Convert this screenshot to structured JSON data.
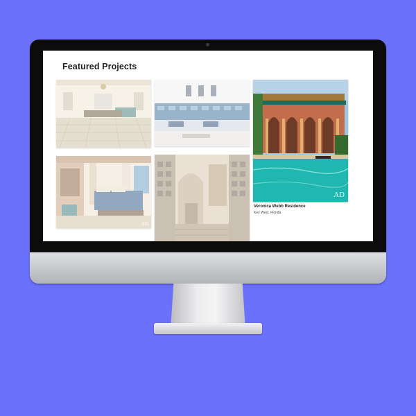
{
  "page": {
    "title": "Featured Projects"
  },
  "projects": [
    {
      "name": "interior-tiled-hall",
      "faded": true
    },
    {
      "name": "interior-lounge-seating",
      "faded": true
    },
    {
      "name": "veronica-webb-residence",
      "faded": false
    },
    {
      "name": "interior-bedroom",
      "faded": true
    },
    {
      "name": "interior-tiled-courtyard",
      "faded": true
    }
  ],
  "featured": {
    "title": "Veronica Webb Residence",
    "location": "Key West, Florida",
    "watermark": "AD"
  },
  "colors": {
    "background": "#6c71fb",
    "bezel": "#0c0c0c",
    "screen": "#ffffff",
    "pool": "#1fb7b0"
  }
}
